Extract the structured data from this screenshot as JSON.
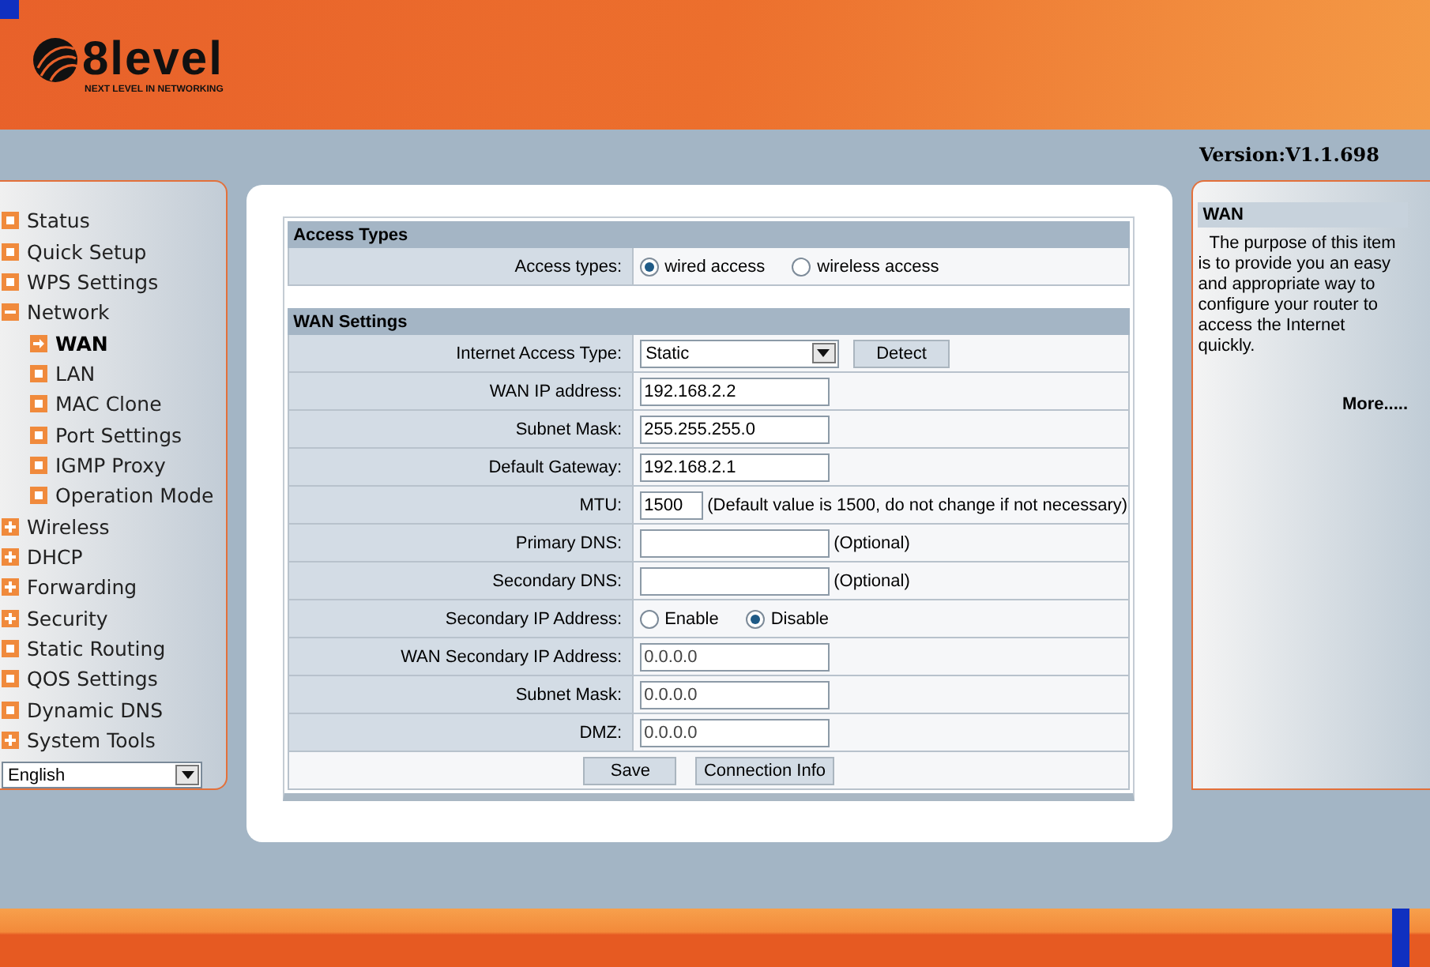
{
  "logo": {
    "name": "8level",
    "tagline": "NEXT LEVEL IN NETWORKING"
  },
  "version": "Version:V1.1.698",
  "sidebar": {
    "items": [
      {
        "label": "Status",
        "selected": false
      },
      {
        "label": "Quick Setup",
        "selected": false
      },
      {
        "label": "WPS Settings",
        "selected": false
      },
      {
        "label": "Network",
        "selected": false,
        "expanded": true,
        "children": [
          {
            "label": "WAN",
            "selected": true
          },
          {
            "label": "LAN",
            "selected": false
          },
          {
            "label": "MAC Clone",
            "selected": false
          },
          {
            "label": "Port Settings",
            "selected": false
          },
          {
            "label": "IGMP Proxy",
            "selected": false
          },
          {
            "label": "Operation Mode",
            "selected": false
          }
        ]
      },
      {
        "label": "Wireless",
        "selected": false,
        "expanded": false
      },
      {
        "label": "DHCP",
        "selected": false,
        "expanded": false
      },
      {
        "label": "Forwarding",
        "selected": false,
        "expanded": false
      },
      {
        "label": "Security",
        "selected": false,
        "expanded": false
      },
      {
        "label": "Static Routing",
        "selected": false
      },
      {
        "label": "QOS Settings",
        "selected": false
      },
      {
        "label": "Dynamic DNS",
        "selected": false
      },
      {
        "label": "System Tools",
        "selected": false,
        "expanded": false
      }
    ],
    "language": "English"
  },
  "sections": [
    {
      "title": "Access Types",
      "rows": [
        {
          "kind": "radio",
          "label": "Access types:",
          "options": [
            {
              "label": "wired access",
              "selected": true
            },
            {
              "label": "wireless access",
              "selected": false
            }
          ]
        }
      ]
    },
    {
      "title": "WAN Settings",
      "rows": [
        {
          "kind": "select",
          "label": "Internet Access Type:",
          "value": "Static",
          "button": "Detect"
        },
        {
          "kind": "text",
          "label": "WAN IP address:",
          "value": "192.168.2.2"
        },
        {
          "kind": "text",
          "label": "Subnet Mask:",
          "value": "255.255.255.0"
        },
        {
          "kind": "text",
          "label": "Default Gateway:",
          "value": "192.168.2.1"
        },
        {
          "kind": "short",
          "label": "MTU:",
          "value": "1500",
          "note": "(Default value is 1500, do not change if not necessary)"
        },
        {
          "kind": "text",
          "label": "Primary DNS:",
          "note": "(Optional)"
        },
        {
          "kind": "text",
          "label": "Secondary DNS:",
          "note": "(Optional)"
        },
        {
          "kind": "radio",
          "label": "Secondary IP Address:",
          "options": [
            {
              "label": "Enable",
              "selected": false
            },
            {
              "label": "Disable",
              "selected": true
            }
          ]
        },
        {
          "kind": "text",
          "label": "WAN Secondary IP Address:",
          "value": "0.0.0.0",
          "disabled": true
        },
        {
          "kind": "text",
          "label": "Subnet Mask:",
          "value": "0.0.0.0",
          "disabled": true
        },
        {
          "kind": "text",
          "label": "DMZ:",
          "value": "0.0.0.0",
          "disabled": true
        }
      ],
      "buttons": [
        "Save",
        "Connection Info"
      ]
    }
  ],
  "help": {
    "title": "WAN",
    "text": "The purpose of this item is to provide you an easy and appropriate way to configure your router to access the Internet quickly.",
    "more": "More....."
  }
}
